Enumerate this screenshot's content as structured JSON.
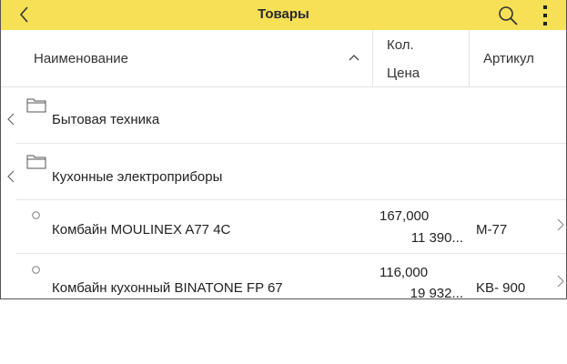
{
  "app": {
    "title": "Товары",
    "accent_color": "#f5e056"
  },
  "toolbar": {
    "back_icon": "chevron-left-icon",
    "search_icon": "search-icon",
    "menu_icon": "more-vertical-icon"
  },
  "columns": {
    "name": "Наименование",
    "qty": "Кол.",
    "price": "Цена",
    "article": "Артикул",
    "sort_direction": "ascending"
  },
  "groups": [
    {
      "label": "Бытовая техника",
      "icon": "folder-icon"
    },
    {
      "label": "Кухонные электроприборы",
      "icon": "folder-icon"
    }
  ],
  "items": [
    {
      "name": "Комбайн MOULINEX  A77 4C",
      "qty": "167,000",
      "price": "11 390...",
      "article": "M-77"
    },
    {
      "name": "Комбайн кухонный BINATONE FP 67",
      "qty": "116,000",
      "price": "19 932...",
      "article": "KB- 900"
    }
  ]
}
